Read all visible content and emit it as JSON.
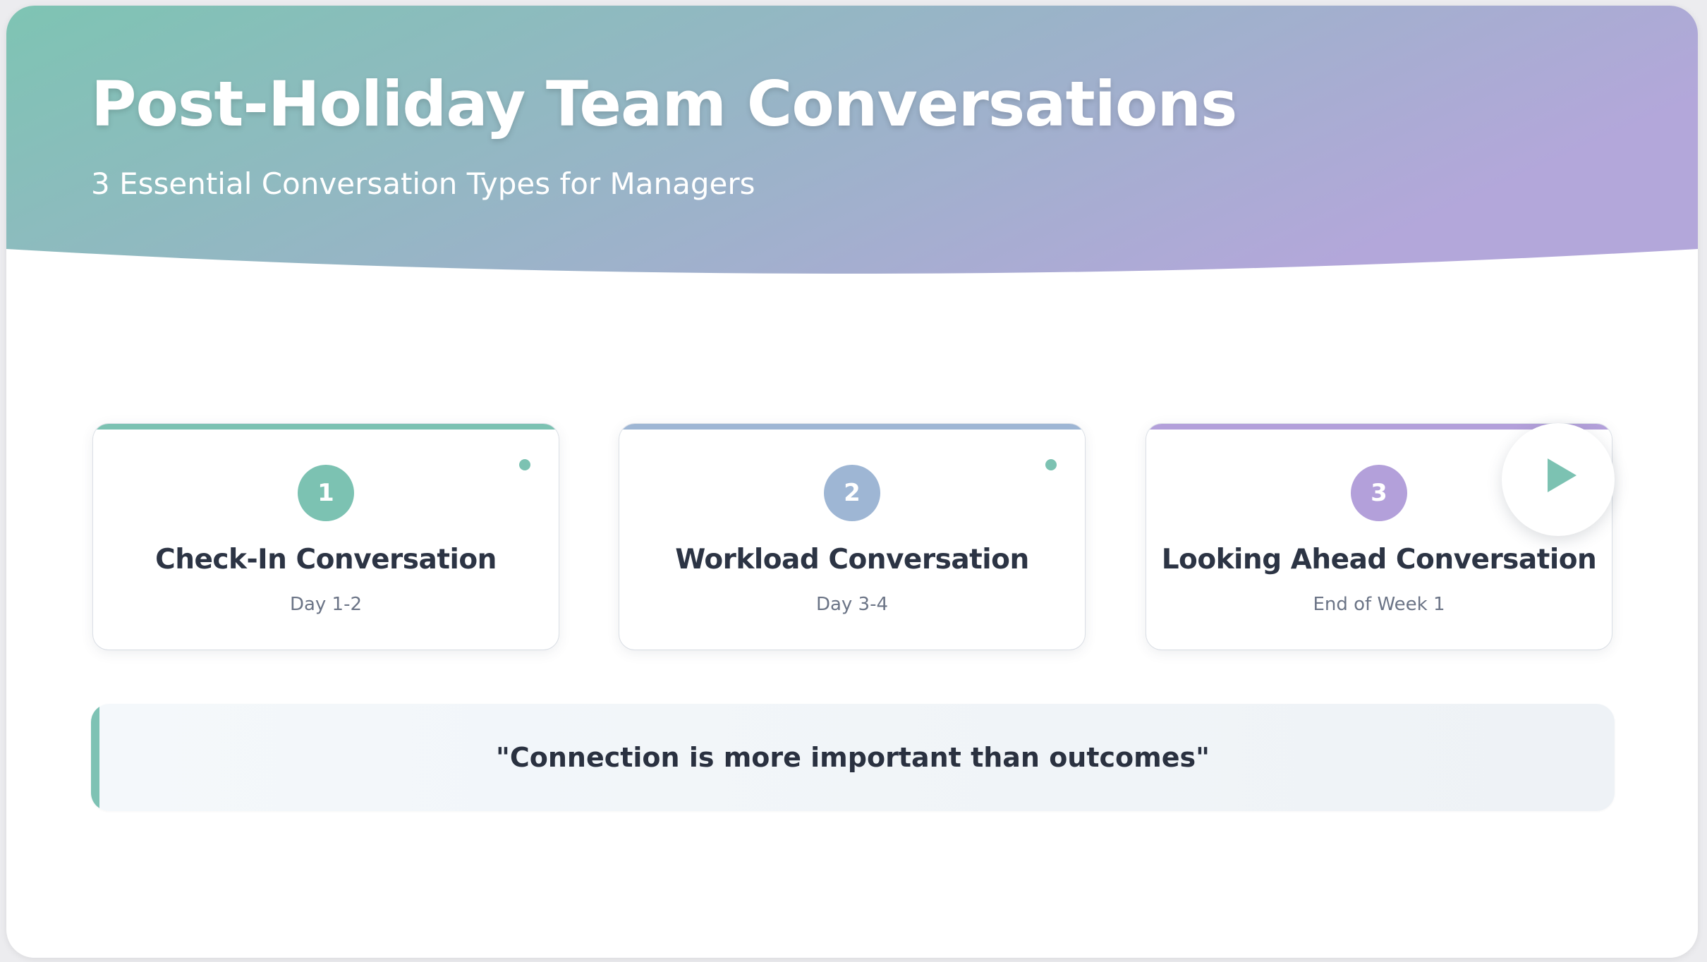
{
  "header": {
    "title": "Post-Holiday Team Conversations",
    "subtitle": "3 Essential Conversation Types for Managers",
    "gradient_start": "#7ec4b3",
    "gradient_end": "#b3a7da"
  },
  "cards": [
    {
      "number": "1",
      "title": "Check-In Conversation",
      "timing": "Day 1-2",
      "color": "#7cc2b2",
      "dot_color": "#7cc2b2"
    },
    {
      "number": "2",
      "title": "Workload Conversation",
      "timing": "Day 3-4",
      "color": "#9eb6d4",
      "dot_color": "#7cc2b2"
    },
    {
      "number": "3",
      "title": "Looking Ahead Conversation",
      "timing": "End of Week 1",
      "color": "#b3a0da",
      "dot_color": "#e6e9ee"
    }
  ],
  "play_button": {
    "icon": "play-icon",
    "color": "#7cc2b2"
  },
  "quote": {
    "text": "\"Connection is more important than outcomes\"",
    "accent_color": "#7ec2b4"
  }
}
